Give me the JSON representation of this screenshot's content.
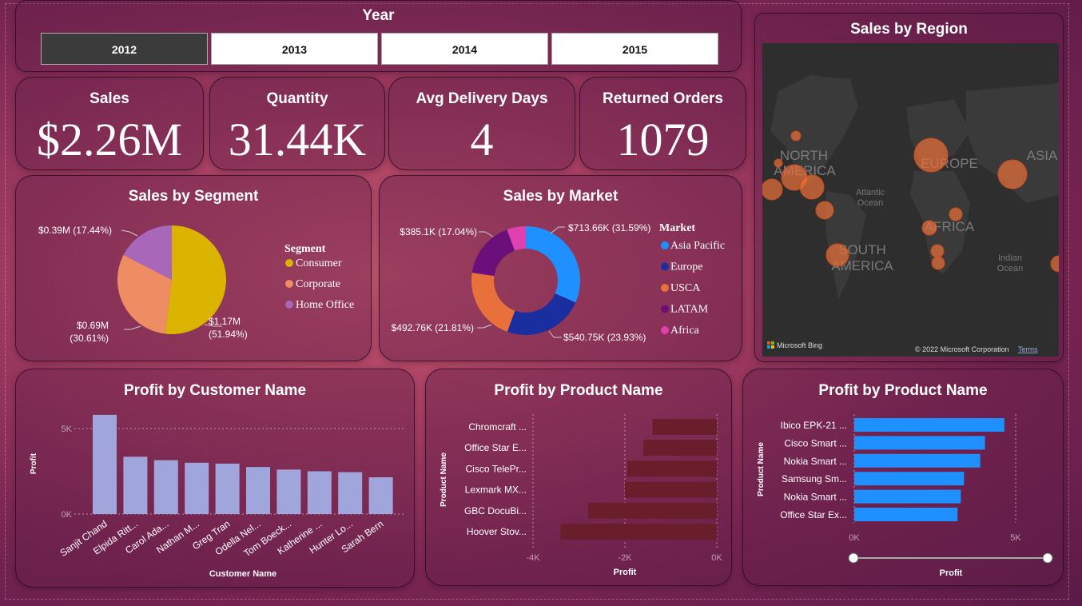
{
  "year_slicer": {
    "title": "Year",
    "options": [
      {
        "label": "2012",
        "selected": true
      },
      {
        "label": "2013",
        "selected": false
      },
      {
        "label": "2014",
        "selected": false
      },
      {
        "label": "2015",
        "selected": false
      }
    ]
  },
  "kpis": [
    {
      "title": "Sales",
      "value": "$2.26M"
    },
    {
      "title": "Quantity",
      "value": "31.44K"
    },
    {
      "title": "Avg Delivery Days",
      "value": "4"
    },
    {
      "title": "Returned Orders",
      "value": "1079"
    }
  ],
  "map": {
    "title": "Sales by Region",
    "labels": {
      "north_america": "NORTH AMERICA",
      "south_america": "SOUTH AMERICA",
      "europe": "EUROPE",
      "asia": "ASIA",
      "africa": "AFRICA",
      "atlantic": "Atlantic Ocean",
      "indian": "Indian Ocean"
    },
    "bing": "Microsoft Bing",
    "copyright": "© 2022 Microsoft Corporation",
    "terms": "Terms"
  },
  "colors": {
    "consumer": "#dbb400",
    "corporate": "#ee8d64",
    "home_office": "#a867b8",
    "asia_pacific": "#1e90ff",
    "europe": "#1a2ea0",
    "usca": "#e8703a",
    "latam": "#6b0f7a",
    "africa": "#e040b0",
    "customer_bar": "#a0a6dc",
    "product_bar_neg": "#6a1e2c",
    "product_bar_pos": "#1e90ff"
  },
  "chart_data": [
    {
      "id": "sales_by_segment",
      "type": "pie",
      "title": "Sales by Segment",
      "legend_title": "Segment",
      "categories": [
        "Consumer",
        "Corporate",
        "Home Office"
      ],
      "values": [
        1.17,
        0.69,
        0.39
      ],
      "labels": [
        "$1.17M (51.94%)",
        "$0.69M (30.61%)",
        "$0.39M (17.44%)"
      ],
      "percents": [
        51.94,
        30.61,
        17.44
      ]
    },
    {
      "id": "sales_by_market",
      "type": "pie",
      "title": "Sales by Market",
      "legend_title": "Market",
      "categories": [
        "Asia Pacific",
        "Europe",
        "USCA",
        "LATAM",
        "Africa"
      ],
      "values": [
        713.66,
        540.75,
        492.76,
        385.1,
        0
      ],
      "labels": [
        "$713.66K (31.59%)",
        "$540.75K (23.93%)",
        "$492.76K (21.81%)",
        "$385.1K (17.04%)"
      ],
      "percents": [
        31.59,
        23.93,
        21.81,
        17.04,
        5.63
      ]
    },
    {
      "id": "profit_by_customer",
      "type": "bar",
      "title": "Profit by Customer Name",
      "xlabel": "Customer Name",
      "ylabel": "Profit",
      "categories": [
        "Sanjit Chand",
        "Elpida Ritt...",
        "Carol Ada...",
        "Nathan M...",
        "Greg Tran",
        "Odella Nel...",
        "Tom Boeck...",
        "Katherine ...",
        "Hunter Lo...",
        "Sarah Bern"
      ],
      "values": [
        5800,
        3350,
        3150,
        3000,
        2950,
        2750,
        2600,
        2500,
        2450,
        2150
      ],
      "yticks": [
        "0K",
        "5K"
      ],
      "ylim": [
        0,
        5000
      ]
    },
    {
      "id": "profit_by_product_bottom",
      "type": "bar",
      "title": "Profit by Product Name",
      "xlabel": "Profit",
      "ylabel": "Product Name",
      "categories": [
        "Chromcraft ...",
        "Office Star E...",
        "Cisco TelePr...",
        "Lexmark MX...",
        "GBC DocuBi...",
        "Hoover Stov..."
      ],
      "values": [
        -1400,
        -1600,
        -1950,
        -2000,
        -2800,
        -3400
      ],
      "xticks": [
        "-4K",
        "-2K",
        "0K"
      ],
      "xlim": [
        -4000,
        0
      ]
    },
    {
      "id": "profit_by_product_top",
      "type": "bar",
      "title": "Profit by Product Name",
      "xlabel": "Profit",
      "ylabel": "Product Name",
      "categories": [
        "Ibico EPK-21 ...",
        "Cisco Smart ...",
        "Nokia Smart ...",
        "Samsung Sm...",
        "Nokia Smart ...",
        "Office Star Ex..."
      ],
      "values": [
        4650,
        4050,
        3900,
        3400,
        3300,
        3200
      ],
      "xticks": [
        "0K",
        "5K"
      ],
      "xlim": [
        0,
        5000
      ]
    }
  ]
}
